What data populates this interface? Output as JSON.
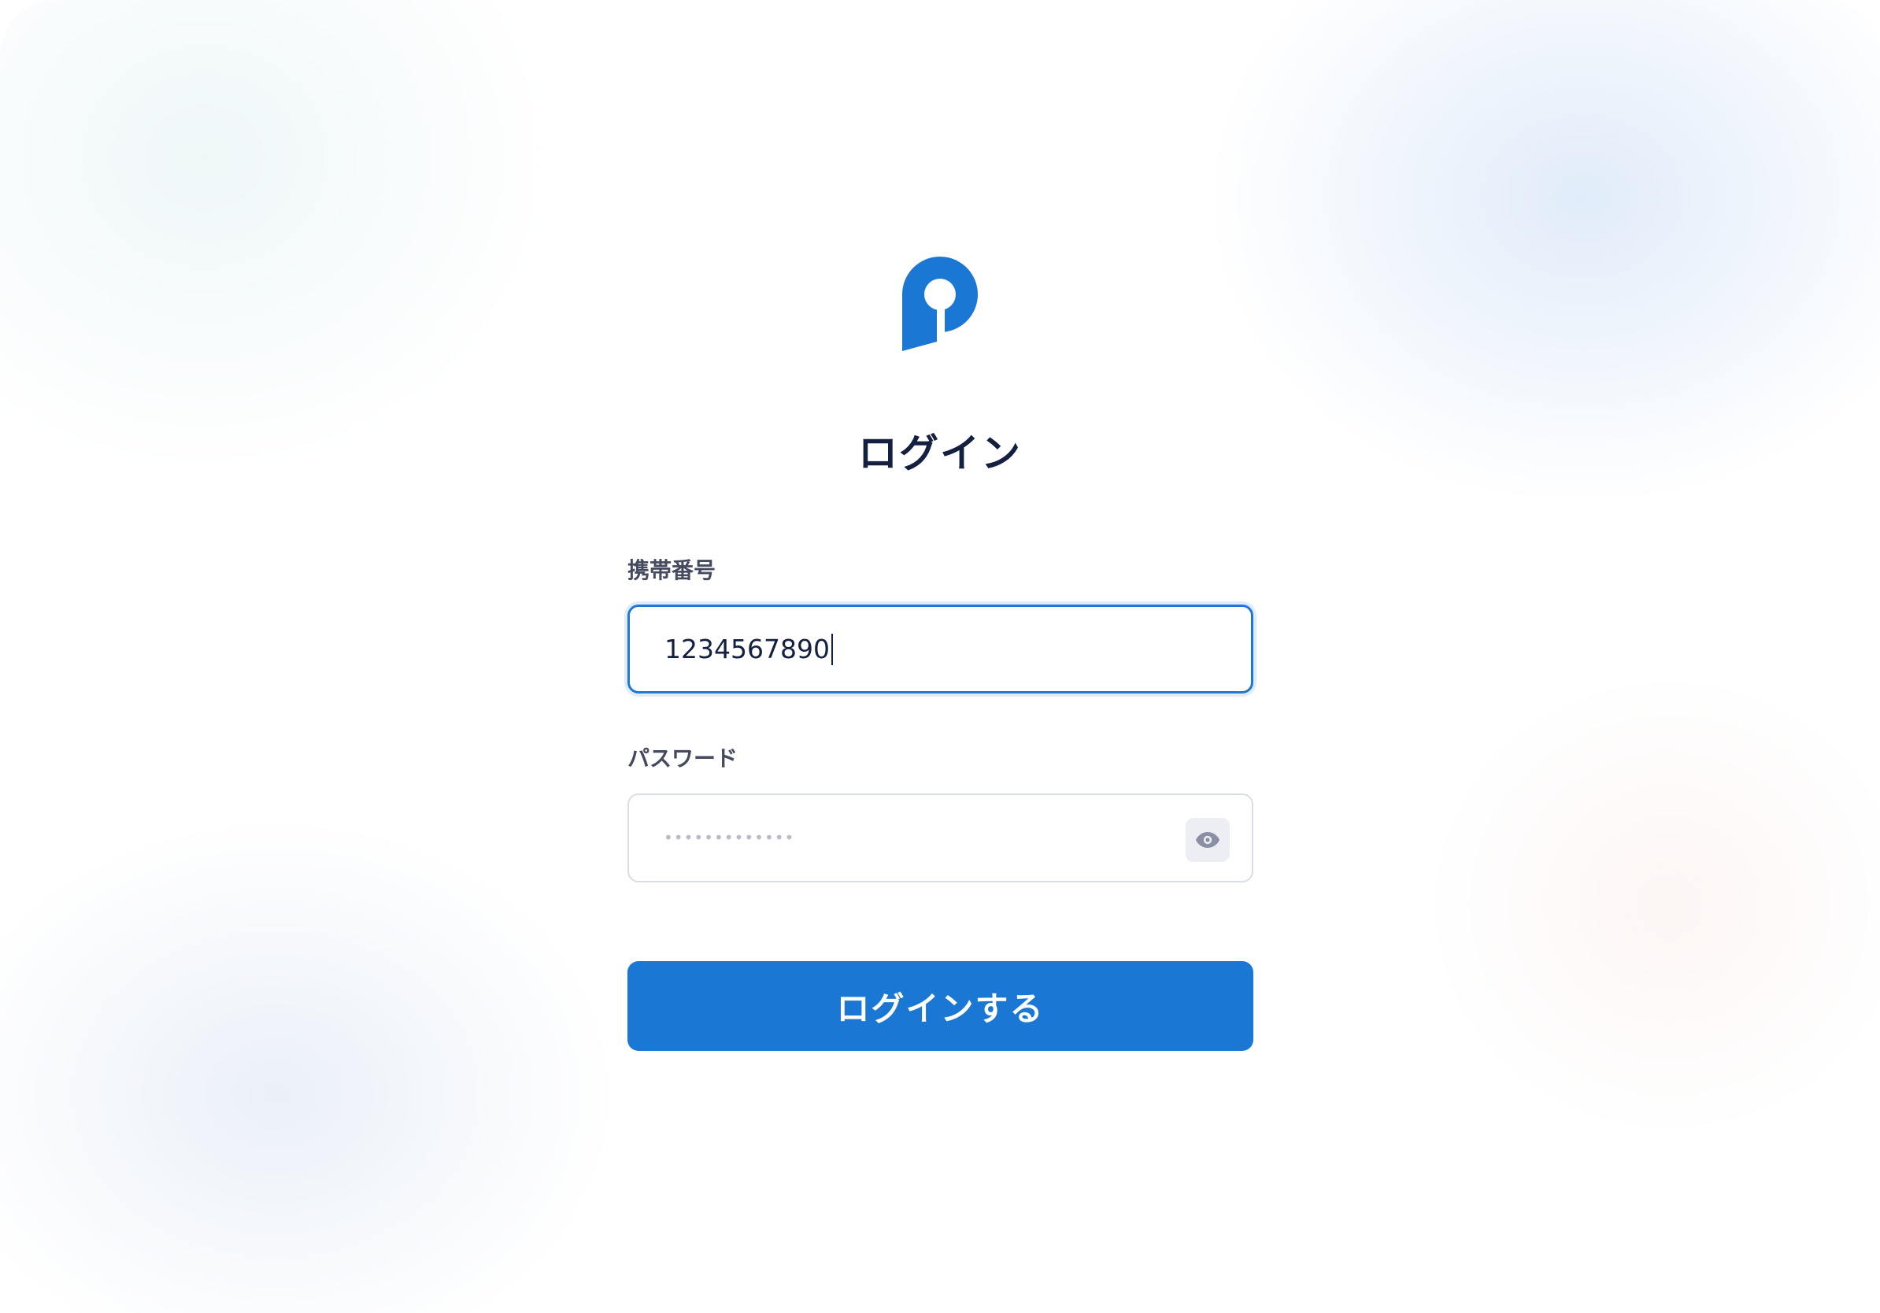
{
  "page": {
    "title": "ログイン"
  },
  "brand": {
    "logo_icon": "p-logo-icon",
    "accent_color": "#1a78d4"
  },
  "form": {
    "phone": {
      "label": "携帯番号",
      "value": "1234567890"
    },
    "password": {
      "label": "パスワード",
      "masked_value": "•••••••••••••",
      "toggle_icon": "eye-icon"
    },
    "submit_label": "ログインする"
  }
}
